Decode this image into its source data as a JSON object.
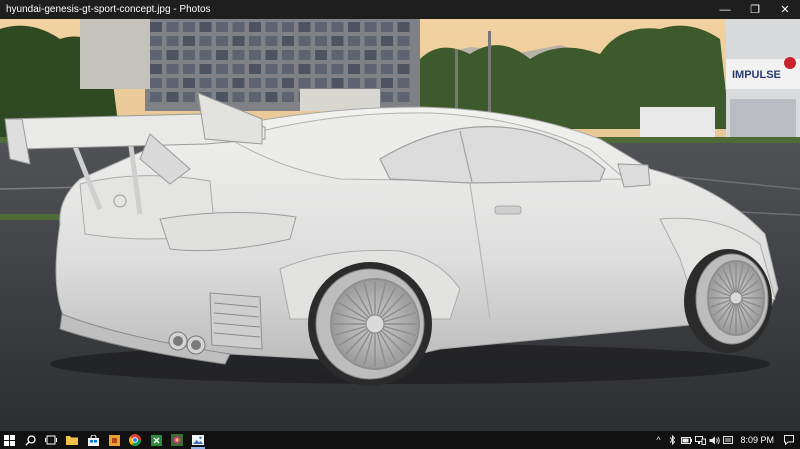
{
  "window": {
    "title": "hyundai-genesis-gt-sport-concept.jpg - Photos",
    "minimize_glyph": "—",
    "maximize_glyph": "❐",
    "close_glyph": "✕"
  },
  "photo": {
    "sign_text": "IMPULSE",
    "colors": {
      "sky": "#e9c99a",
      "asphalt": "#3b3d40",
      "car_body": "#e8e8e6",
      "foliage": "#3d5a2c"
    }
  },
  "taskbar": {
    "apps": [
      {
        "name": "start-icon",
        "active": false
      },
      {
        "name": "search-icon",
        "active": false
      },
      {
        "name": "task-view-icon",
        "active": false
      },
      {
        "name": "file-explorer-icon",
        "active": false
      },
      {
        "name": "store-icon",
        "active": false
      },
      {
        "name": "app-orange-icon",
        "active": false
      },
      {
        "name": "chrome-icon",
        "active": false
      },
      {
        "name": "app-green-icon",
        "active": false
      },
      {
        "name": "game-icon",
        "active": false
      },
      {
        "name": "photos-icon",
        "active": true
      }
    ],
    "tray": {
      "chevron": "^",
      "clock": "8:09 PM"
    }
  }
}
